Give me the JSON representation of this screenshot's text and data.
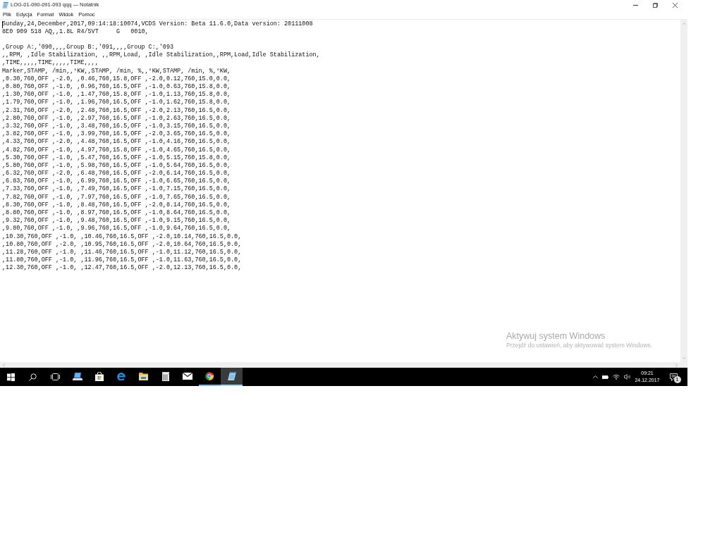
{
  "window": {
    "title": "LOG-01-090-091-093 qqq — Notatnik"
  },
  "menu": [
    "Plik",
    "Edycja",
    "Format",
    "Widok",
    "Pomoc"
  ],
  "document": {
    "header_lines": [
      "Sunday,24,December,2017,09:14:18:10074,VCDS Version: Beta 11.6.0,Data version: 20111008",
      "8E0 909 518 AQ,,1.8L R4/5VT     G   0010,"
    ],
    "data_lines": [
      ",Group A:,'090,,,,Group B:,'091,,,,Group C:,'093",
      ",,RPM, ,Idle Stabilization, ,,RPM,Load, ,Idle Stabilization,,RPM,Load,Idle Stabilization,",
      ",TIME,,,,,TIME,,,,,TIME,,,,",
      "Marker,STAMP, /min,,°KW,,STAMP, /min, %,,°KW,STAMP, /min, %,°KW,",
      ",0.30,760,OFF ,-2.0, ,0.46,760,15.8,OFF ,-2.0,0.12,760,15.0,0.0,",
      ",0.80,760,OFF ,-1.0, ,0.96,760,16.5,OFF ,-1.0,0.63,760,15.8,0.0,",
      ",1.30,760,OFF ,-1.0, ,1.47,760,15.8,OFF ,-1.0,1.13,760,15.8,0.0,",
      ",1.79,760,OFF ,-1.0, ,1.96,760,16.5,OFF ,-1.0,1.62,760,15.8,0.0,",
      ",2.31,760,OFF ,-2.0, ,2.48,760,16.5,OFF ,-2.0,2.13,760,16.5,0.0,",
      ",2.80,760,OFF ,-1.0, ,2.97,760,16.5,OFF ,-1.0,2.63,760,16.5,0.0,",
      ",3.32,760,OFF ,-1.0, ,3.48,760,16.5,OFF ,-1.0,3.15,760,16.5,0.0,",
      ",3.82,760,OFF ,-1.0, ,3.99,760,16.5,OFF ,-2.0,3.65,760,16.5,0.0,",
      ",4.33,760,OFF ,-2.0, ,4.48,760,16.5,OFF ,-1.0,4.16,760,16.5,0.0,",
      ",4.82,760,OFF ,-1.0, ,4.97,760,15.8,OFF ,-1.0,4.65,760,16.5,0.0,",
      ",5.30,760,OFF ,-1.0, ,5.47,760,16.5,OFF ,-1.0,5.15,760,15.8,0.0,",
      ",5.80,760,OFF ,-1.0, ,5.98,760,16.5,OFF ,-1.0,5.64,760,16.5,0.0,",
      ",6.32,760,OFF ,-2.0, ,6.48,760,16.5,OFF ,-2.0,6.14,760,16.5,0.0,",
      ",6.83,760,OFF ,-1.0, ,6.99,760,16.5,OFF ,-1.0,6.65,760,16.5,0.0,",
      ",7.33,760,OFF ,-1.0, ,7.49,760,16.5,OFF ,-1.0,7.15,760,16.5,0.0,",
      ",7.82,760,OFF ,-1.0, ,7.97,760,16.5,OFF ,-1.0,7.65,760,16.5,0.0,",
      ",8.30,760,OFF ,-1.0, ,8.48,760,16.5,OFF ,-2.0,8.14,760,16.5,0.0,",
      ",8.80,760,OFF ,-1.0, ,8.97,760,16.5,OFF ,-1.0,8.64,760,16.5,0.0,",
      ",9.32,760,OFF ,-1.0, ,9.48,760,16.5,OFF ,-1.0,9.15,760,16.5,0.0,",
      ",9.80,760,OFF ,-1.0, ,9.96,760,16.5,OFF ,-1.0,9.64,760,16.5,0.0,",
      ",10.30,760,OFF ,-1.0, ,10.46,760,16.5,OFF ,-2.0,10.14,760,16.5,0.0,",
      ",10.80,760,OFF ,-2.0, ,10.95,760,16.5,OFF ,-2.0,10.64,760,16.5,0.0,",
      ",11.28,760,OFF ,-1.0, ,11.46,760,16.5,OFF ,-1.0,11.12,760,16.5,0.0,",
      ",11.80,760,OFF ,-1.0, ,11.96,760,16.5,OFF ,-1.0,11.63,760,16.5,0.0,",
      ",12.30,760,OFF ,-1.0, ,12.47,760,16.5,OFF ,-2.0,12.13,760,16.5,0.0,"
    ]
  },
  "activation_notice": {
    "title": "Aktywuj system Windows",
    "text": "Przejdź do ustawień, aby aktywować system Windows."
  },
  "taskbar": {
    "apps": [
      {
        "kind": "computer",
        "running": false,
        "selected": false
      },
      {
        "kind": "store",
        "running": false,
        "selected": false
      },
      {
        "kind": "edge",
        "running": false,
        "selected": false
      },
      {
        "kind": "explorer",
        "running": false,
        "selected": false
      },
      {
        "kind": "calculator",
        "running": false,
        "selected": false
      },
      {
        "kind": "mail",
        "running": false,
        "selected": false
      },
      {
        "kind": "chrome",
        "running": true,
        "selected": false
      },
      {
        "kind": "notepad",
        "running": true,
        "selected": true
      }
    ],
    "clock": {
      "time": "09:21",
      "date": "24.12.2017"
    },
    "notifications": {
      "count": "1"
    }
  }
}
